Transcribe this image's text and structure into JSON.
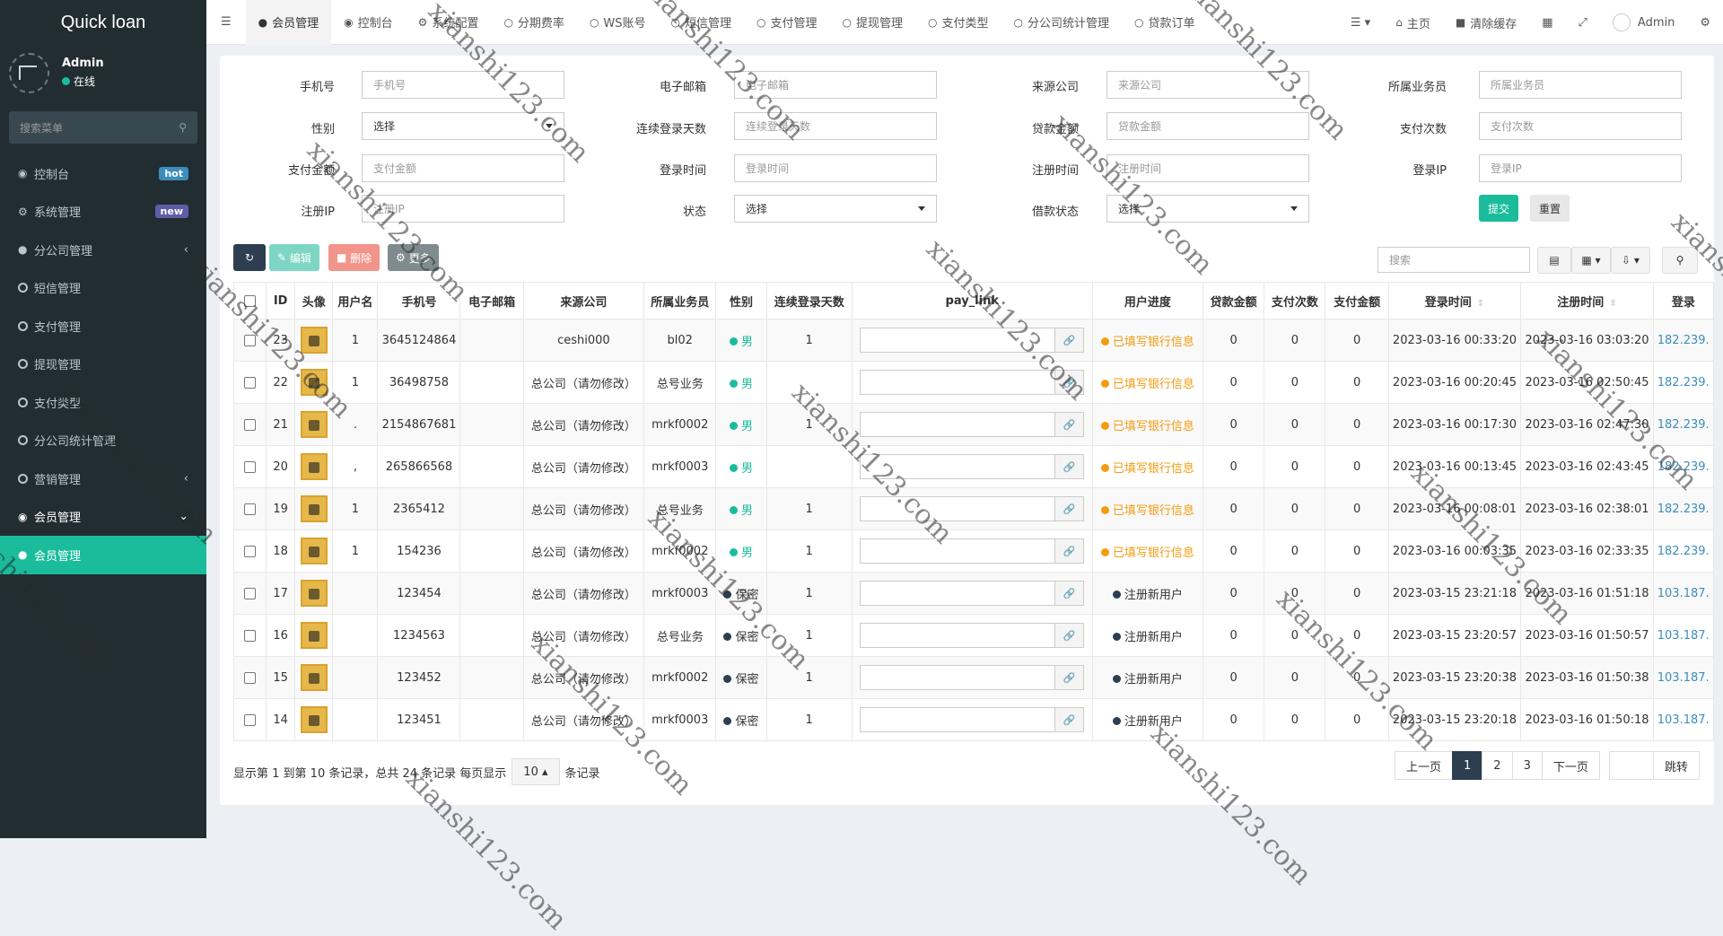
{
  "app": {
    "title": "Quick loan"
  },
  "user": {
    "name": "Admin",
    "status": "在线"
  },
  "sidebar": {
    "search_placeholder": "搜索菜单",
    "items": [
      {
        "label": "控制台",
        "badge": "hot",
        "badge_color": "#3c8dbc"
      },
      {
        "label": "系统管理",
        "badge": "new",
        "badge_color": "#605ca8"
      },
      {
        "label": "分公司管理"
      },
      {
        "label": "短信管理"
      },
      {
        "label": "支付管理"
      },
      {
        "label": "提现管理"
      },
      {
        "label": "支付类型"
      },
      {
        "label": "分公司统计管理"
      },
      {
        "label": "营销管理"
      },
      {
        "label": "会员管理"
      },
      {
        "label": "会员管理"
      }
    ]
  },
  "topnav": {
    "tabs": [
      "会员管理",
      "控制台",
      "系统配置",
      "分期费率",
      "WS账号",
      "短信管理",
      "支付管理",
      "提现管理",
      "支付类型",
      "分公司统计管理",
      "贷款订单"
    ],
    "right": {
      "home": "主页",
      "clear_cache": "清除缓存",
      "admin": "Admin"
    }
  },
  "filters": {
    "phone": {
      "label": "手机号",
      "placeholder": "手机号"
    },
    "email": {
      "label": "电子邮箱",
      "placeholder": "电子邮箱"
    },
    "source": {
      "label": "来源公司",
      "placeholder": "来源公司"
    },
    "salesman": {
      "label": "所属业务员",
      "placeholder": "所属业务员"
    },
    "gender": {
      "label": "性别",
      "value": "选择"
    },
    "streak": {
      "label": "连续登录天数",
      "placeholder": "连续登录天数"
    },
    "loan_amount": {
      "label": "贷款金额",
      "placeholder": "贷款金额"
    },
    "pay_count": {
      "label": "支付次数",
      "placeholder": "支付次数"
    },
    "pay_amount": {
      "label": "支付金额",
      "placeholder": "支付金额"
    },
    "login_time": {
      "label": "登录时间",
      "placeholder": "登录时间"
    },
    "reg_time": {
      "label": "注册时间",
      "placeholder": "注册时间"
    },
    "login_ip": {
      "label": "登录IP",
      "placeholder": "登录IP"
    },
    "reg_ip": {
      "label": "注册IP",
      "placeholder": "注册IP"
    },
    "state": {
      "label": "状态",
      "value": "选择"
    },
    "loan_state": {
      "label": "借款状态",
      "value": "选择"
    },
    "submit": "提交",
    "reset": "重置"
  },
  "toolbar": {
    "edit": "编辑",
    "delete": "删除",
    "more": "更多",
    "search_placeholder": "搜索"
  },
  "table": {
    "columns": [
      "ID",
      "头像",
      "用户名",
      "手机号",
      "电子邮箱",
      "来源公司",
      "所属业务员",
      "性别",
      "连续登录天数",
      "pay_link",
      "用户进度",
      "贷款金额",
      "支付次数",
      "支付金额",
      "登录时间",
      "注册时间",
      "登录"
    ],
    "rows": [
      {
        "id": "23",
        "username": "1",
        "phone": "3645124864",
        "email": "",
        "source": "ceshi000",
        "salesman": "bl02",
        "gender": "男",
        "streak": "1",
        "progress": "已填写银行信息",
        "loan": "0",
        "pay_count": "0",
        "pay_amount": "0",
        "login_time": "2023-03-16 00:33:20",
        "reg_time": "2023-03-16 03:03:20",
        "login_ip": "182.239."
      },
      {
        "id": "22",
        "username": "1",
        "phone": "36498758",
        "email": "",
        "source": "总公司（请勿修改）",
        "salesman": "总号业务",
        "gender": "男",
        "streak": "",
        "progress": "已填写银行信息",
        "loan": "0",
        "pay_count": "0",
        "pay_amount": "0",
        "login_time": "2023-03-16 00:20:45",
        "reg_time": "2023-03-16 02:50:45",
        "login_ip": "182.239."
      },
      {
        "id": "21",
        "username": ".",
        "phone": "2154867681",
        "email": "",
        "source": "总公司（请勿修改）",
        "salesman": "mrkf0002",
        "gender": "男",
        "streak": "1",
        "progress": "已填写银行信息",
        "loan": "0",
        "pay_count": "0",
        "pay_amount": "0",
        "login_time": "2023-03-16 00:17:30",
        "reg_time": "2023-03-16 02:47:30",
        "login_ip": "182.239."
      },
      {
        "id": "20",
        "username": ",",
        "phone": "265866568",
        "email": "",
        "source": "总公司（请勿修改）",
        "salesman": "mrkf0003",
        "gender": "男",
        "streak": "",
        "progress": "已填写银行信息",
        "loan": "0",
        "pay_count": "0",
        "pay_amount": "0",
        "login_time": "2023-03-16 00:13:45",
        "reg_time": "2023-03-16 02:43:45",
        "login_ip": "182.239."
      },
      {
        "id": "19",
        "username": "1",
        "phone": "2365412",
        "email": "",
        "source": "总公司（请勿修改）",
        "salesman": "总号业务",
        "gender": "男",
        "streak": "1",
        "progress": "已填写银行信息",
        "loan": "0",
        "pay_count": "0",
        "pay_amount": "0",
        "login_time": "2023-03-16 00:08:01",
        "reg_time": "2023-03-16 02:38:01",
        "login_ip": "182.239."
      },
      {
        "id": "18",
        "username": "1",
        "phone": "154236",
        "email": "",
        "source": "总公司（请勿修改）",
        "salesman": "mrkf0002",
        "gender": "男",
        "streak": "1",
        "progress": "已填写银行信息",
        "loan": "0",
        "pay_count": "0",
        "pay_amount": "0",
        "login_time": "2023-03-16 00:03:35",
        "reg_time": "2023-03-16 02:33:35",
        "login_ip": "182.239."
      },
      {
        "id": "17",
        "username": "",
        "phone": "123454",
        "email": "",
        "source": "总公司（请勿修改）",
        "salesman": "mrkf0003",
        "gender": "保密",
        "streak": "1",
        "progress": "注册新用户",
        "loan": "0",
        "pay_count": "0",
        "pay_amount": "0",
        "login_time": "2023-03-15 23:21:18",
        "reg_time": "2023-03-16 01:51:18",
        "login_ip": "103.187."
      },
      {
        "id": "16",
        "username": "",
        "phone": "1234563",
        "email": "",
        "source": "总公司（请勿修改）",
        "salesman": "总号业务",
        "gender": "保密",
        "streak": "1",
        "progress": "注册新用户",
        "loan": "0",
        "pay_count": "0",
        "pay_amount": "0",
        "login_time": "2023-03-15 23:20:57",
        "reg_time": "2023-03-16 01:50:57",
        "login_ip": "103.187."
      },
      {
        "id": "15",
        "username": "",
        "phone": "123452",
        "email": "",
        "source": "总公司（请勿修改）",
        "salesman": "mrkf0002",
        "gender": "保密",
        "streak": "1",
        "progress": "注册新用户",
        "loan": "0",
        "pay_count": "0",
        "pay_amount": "0",
        "login_time": "2023-03-15 23:20:38",
        "reg_time": "2023-03-16 01:50:38",
        "login_ip": "103.187."
      },
      {
        "id": "14",
        "username": "",
        "phone": "123451",
        "email": "",
        "source": "总公司（请勿修改）",
        "salesman": "mrkf0003",
        "gender": "保密",
        "streak": "1",
        "progress": "注册新用户",
        "loan": "0",
        "pay_count": "0",
        "pay_amount": "0",
        "login_time": "2023-03-15 23:20:18",
        "reg_time": "2023-03-16 01:50:18",
        "login_ip": "103.187."
      }
    ]
  },
  "footer": {
    "summary": "显示第 1 到第 10 条记录，总共 24 条记录 每页显示",
    "page_size": "10",
    "records_suffix": "条记录",
    "prev": "上一页",
    "pages": [
      "1",
      "2",
      "3"
    ],
    "next": "下一页",
    "jump": "跳转"
  },
  "watermark": "xianshi123.com",
  "colors": {
    "teal": "#1abc9c",
    "sidebar_bg": "#222d32",
    "orange": "#f39c12",
    "edit_btn": "#7dd6c4",
    "delete_btn": "#f1948a",
    "more_btn": "#7f8c8d",
    "refresh_btn": "#2c3e50"
  }
}
